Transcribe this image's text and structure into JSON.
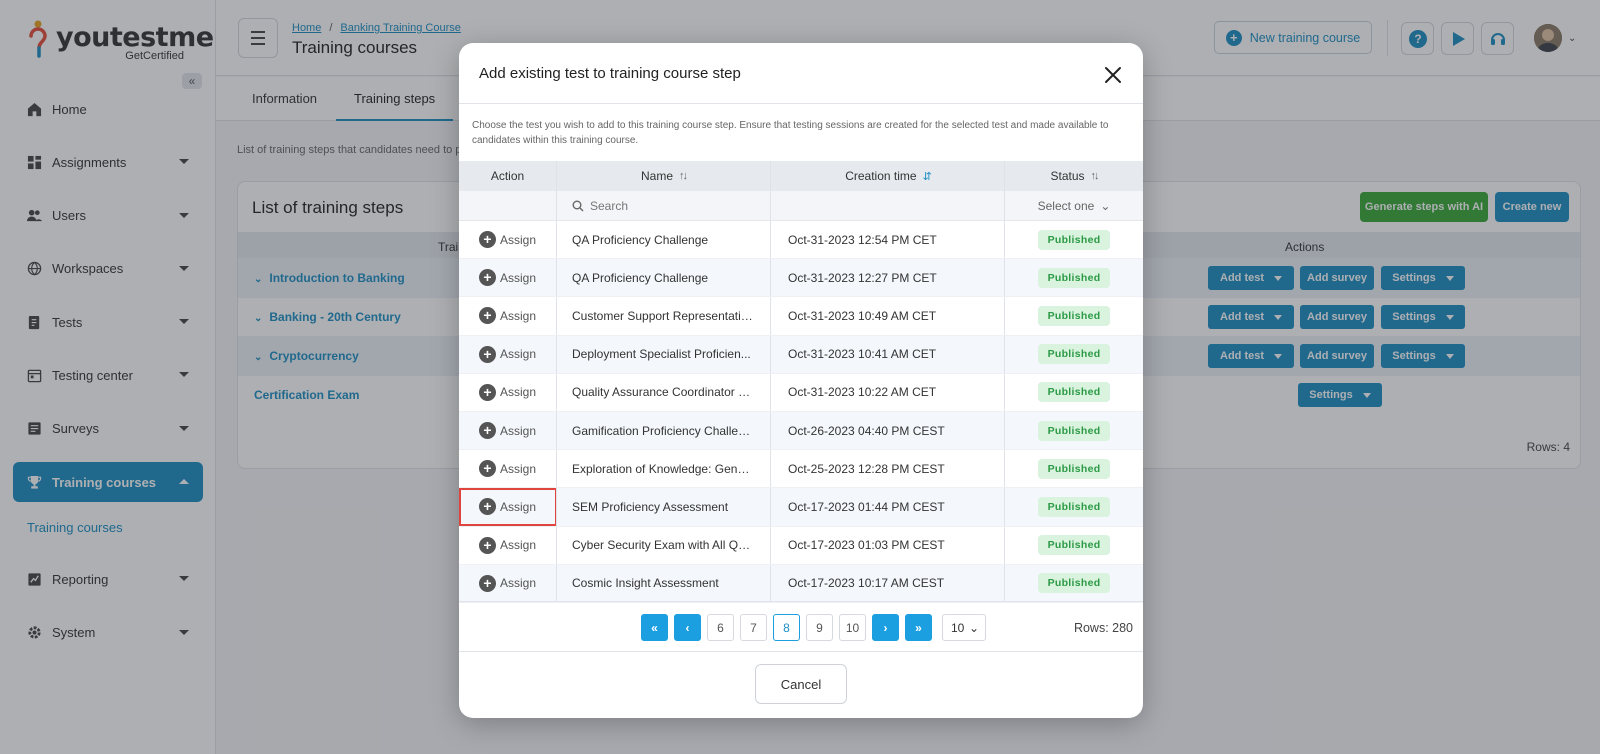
{
  "app": {
    "logo_text": "youtestme",
    "logo_sub": "GetCertified",
    "collapse_icon": "«"
  },
  "sidebar": {
    "items": [
      {
        "label": "Home",
        "icon": "home-icon",
        "has_caret": false
      },
      {
        "label": "Assignments",
        "icon": "assignments-icon",
        "has_caret": true
      },
      {
        "label": "Users",
        "icon": "users-icon",
        "has_caret": true
      },
      {
        "label": "Workspaces",
        "icon": "globe-icon",
        "has_caret": true
      },
      {
        "label": "Tests",
        "icon": "tests-icon",
        "has_caret": true
      },
      {
        "label": "Testing center",
        "icon": "calendar-icon",
        "has_caret": true
      },
      {
        "label": "Surveys",
        "icon": "surveys-icon",
        "has_caret": true
      },
      {
        "label": "Training courses",
        "icon": "trophy-icon",
        "has_caret": true,
        "active": true
      },
      {
        "label": "Reporting",
        "icon": "reporting-icon",
        "has_caret": true
      },
      {
        "label": "System",
        "icon": "gear-icon",
        "has_caret": true
      }
    ],
    "sub_item": "Training courses"
  },
  "header": {
    "breadcrumb_home": "Home",
    "breadcrumb_sep": "/",
    "breadcrumb_course": "Banking Training Course",
    "title": "Training courses",
    "new_course_label": "New training course"
  },
  "tabs": [
    {
      "label": "Information"
    },
    {
      "label": "Training steps",
      "active": true
    }
  ],
  "page": {
    "description": "List of training steps that candidates need to pas"
  },
  "steps": {
    "title": "List of training steps",
    "generate_label": "Generate steps with AI",
    "create_label": "Create new",
    "col_training": "Trai",
    "col_actions": "Actions",
    "rows": [
      {
        "name": "Introduction to Banking",
        "chev": "⌄"
      },
      {
        "name": "Banking - 20th Century",
        "chev": "⌄"
      },
      {
        "name": "Cryptocurrency",
        "chev": "⌄"
      },
      {
        "name": "Certification Exam"
      }
    ],
    "add_test_label": "Add test",
    "add_survey_label": "Add survey",
    "settings_label": "Settings",
    "rows_count": "Rows: 4"
  },
  "modal": {
    "title": "Add existing test to training course step",
    "description": "Choose the test you wish to add to this training course step. Ensure that testing sessions are created for the selected test and made available to candidates within this training course.",
    "columns": {
      "action": "Action",
      "name": "Name",
      "creation_time": "Creation time",
      "status": "Status"
    },
    "sort_icon": "↑↓",
    "sort_active_icon": "⇵",
    "search_placeholder": "Search",
    "status_filter": "Select one",
    "assign_label": "Assign",
    "plus_glyph": "+",
    "rows": [
      {
        "name": "QA Proficiency Challenge",
        "time": "Oct-31-2023 12:54 PM CET",
        "status": "Published"
      },
      {
        "name": "QA Proficiency Challenge",
        "time": "Oct-31-2023 12:27 PM CET",
        "status": "Published"
      },
      {
        "name": "Customer Support Representativ...",
        "time": "Oct-31-2023 10:49 AM CET",
        "status": "Published"
      },
      {
        "name": "Deployment Specialist Proficien...",
        "time": "Oct-31-2023 10:41 AM CET",
        "status": "Published"
      },
      {
        "name": "Quality Assurance Coordinator P...",
        "time": "Oct-31-2023 10:22 AM CET",
        "status": "Published"
      },
      {
        "name": "Gamification Proficiency Challen...",
        "time": "Oct-26-2023 04:40 PM CEST",
        "status": "Published"
      },
      {
        "name": "Exploration of Knowledge: Gener...",
        "time": "Oct-25-2023 12:28 PM CEST",
        "status": "Published"
      },
      {
        "name": "SEM Proficiency Assessment",
        "time": "Oct-17-2023 01:44 PM CEST",
        "status": "Published",
        "highlight": true
      },
      {
        "name": "Cyber Security Exam with All Qu...",
        "time": "Oct-17-2023 01:03 PM CEST",
        "status": "Published"
      },
      {
        "name": "Cosmic Insight Assessment",
        "time": "Oct-17-2023 10:17 AM CEST",
        "status": "Published"
      }
    ],
    "pager": {
      "first": "«",
      "prev": "‹",
      "next": "›",
      "last": "»",
      "pages": [
        "6",
        "7",
        "8",
        "9",
        "10"
      ],
      "current": "8",
      "page_size": "10",
      "rows": "Rows: 280"
    },
    "cancel_label": "Cancel"
  },
  "colors": {
    "accent": "#1c8ec4",
    "green": "#37a836",
    "badge_bg": "#d9f3df",
    "highlight": "#e0443e"
  }
}
